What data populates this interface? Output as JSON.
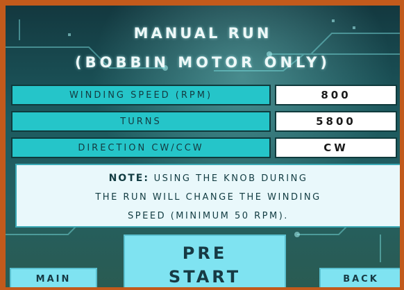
{
  "screen": {
    "title_line1": "MANUAL RUN",
    "title_line2": "(BOBBIN MOTOR ONLY)"
  },
  "settings": [
    {
      "label": "WINDING SPEED (RPM)",
      "value": "800"
    },
    {
      "label": "TURNS",
      "value": "5800"
    },
    {
      "label": "DIRECTION CW/CCW",
      "value": "CW"
    }
  ],
  "note": {
    "prefix": "NOTE:",
    "line1": " USING THE KNOB DURING",
    "line2": "THE RUN WILL CHANGE THE WINDING",
    "line3": "SPEED (MINIMUM 50 RPM)."
  },
  "buttons": {
    "main": "MAIN",
    "pre_start_line1": "PRE",
    "pre_start_line2": "START",
    "back": "BACK"
  },
  "colors": {
    "frame": "#c25a1c",
    "label_bg": "#25c5c9",
    "button_bg": "#7fe3f1",
    "note_bg": "#e9f8fb"
  }
}
